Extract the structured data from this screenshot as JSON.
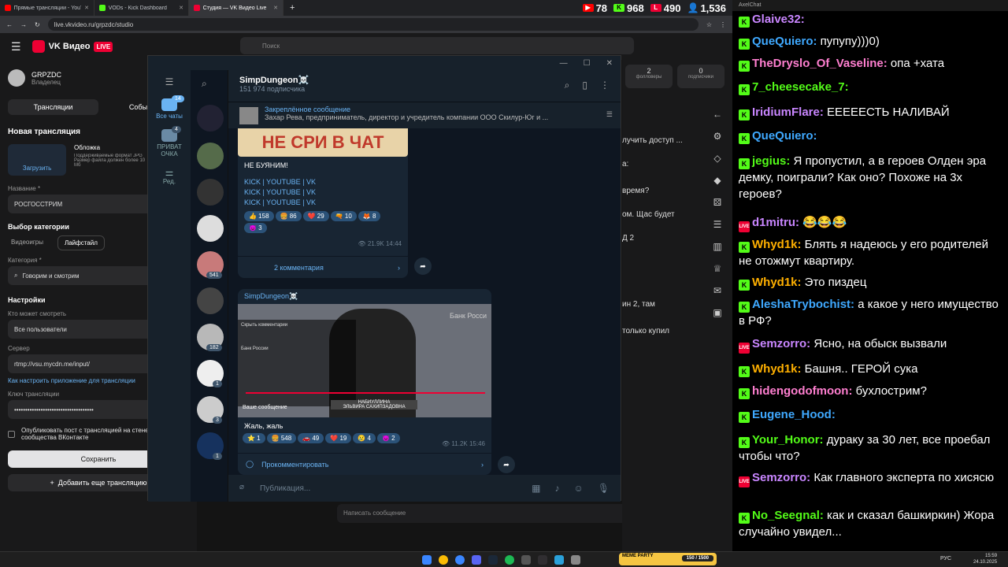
{
  "tabs": [
    {
      "label": "Прямые трансляции - YouTube",
      "color": "#ff0000"
    },
    {
      "label": "VODs - Kick Dashboard",
      "color": "#53fc18"
    },
    {
      "label": "Студия — VK Видео Live",
      "color": "#e03"
    }
  ],
  "stats": {
    "youtube": "78",
    "kick": "968",
    "vk": "490",
    "viewers": "1,536"
  },
  "address": {
    "url": "live.vkvideo.ru/grpzdc/studio"
  },
  "vk": {
    "logo": "VK Видео",
    "live": "LIVE",
    "search_placeholder": "Поиск",
    "channel": "GRPZDC",
    "role": "Владелец",
    "tab_streams": "Трансляции",
    "tab_events": "События",
    "new_stream": "Новая трансляция",
    "upload": "Загрузить",
    "cover_title": "Обложка",
    "cover_desc": "Поддерживаемые формат JPG Размер файла должен более 10 Мб",
    "name_label": "Название *",
    "name_value": "РОСГОССТРИМ",
    "category_title": "Выбор категории",
    "cat_games": "Видеоигры",
    "cat_life": "Лайфстайл",
    "category_label": "Категория *",
    "category_value": "Говорим и смотрим",
    "settings": "Настройки",
    "who_label": "Кто может смотреть",
    "who_value": "Все пользователи",
    "server_label": "Сервер",
    "server_value": "rtmp://vsu.mycdn.me/input/",
    "howto": "Как настроить приложение для трансляции",
    "key_label": "Ключ трансляции",
    "key_value": "••••••••••••••••••••••••••••••••••••",
    "publish": "Опубликовать пост с трансляцией на стене сообщества ВКонтакте",
    "save": "Сохранить",
    "add_more": "Добавить еще трансляцию",
    "followers": "2",
    "followers_label": "фолловеры",
    "subs": "0",
    "subs_label": "подписчики",
    "write_placeholder": "Написать сообщение",
    "side_lines": [
      "лучить доступ ...",
      "а:",
      "время?",
      "ом. Щас будет",
      "Д 2",
      "ин 2, там",
      "только купил"
    ]
  },
  "telegram": {
    "folder_all": "Все чаты",
    "folder_all_count": "14",
    "folder_private": "ПРИВАТ ОЧКА",
    "folder_private_count": "4",
    "folder_edit": "Ред.",
    "list_counts": [
      "541",
      "182",
      "1",
      "3",
      "1"
    ],
    "channel_name": "SimpDungeon☠️",
    "subscribers": "151 974 подписчика",
    "pinned_title": "Закреплённое сообщение",
    "pinned_body": "Захар Рева, предприниматель, директор и учредитель компании ООО Скилур-Юг и ...",
    "post1": {
      "banner": "НЕ СРИ В ЧАТ",
      "line1": "НЕ БУЯНИМ!",
      "links": [
        "KICK | YOUTUBE | VK",
        "KICK | YOUTUBE | VK",
        "KICK | YOUTUBE | VK"
      ],
      "reactions": [
        "👍 158",
        "🍔 86",
        "❤️ 29",
        "🔫 10",
        "🦊 8",
        "😈 3"
      ],
      "views": "21.9K",
      "time": "14:44",
      "comments": "2 комментария"
    },
    "post2": {
      "author": "SimpDungeon☠️",
      "video_top": "Скрыть комментарии",
      "video_bank": "Банк России",
      "video_name": "НАБИУЛЛИНА",
      "video_sub": "ЭЛЬВИРА САХИПЗАДОВНА",
      "video_msg": "Ваше сообщение",
      "video_bank_right": "Банк Росси",
      "text": "Жаль, жаль",
      "reactions": [
        "⭐ 1",
        "🍔 548",
        "🚗 49",
        "❤️ 19",
        "😢 4",
        "😈 2"
      ],
      "views": "11.2K",
      "time": "15:46",
      "comment_btn": "Прокомментировать"
    },
    "compose_placeholder": "Публикация..."
  },
  "chat": {
    "title": "AxelChat",
    "messages": [
      {
        "badge": "kick",
        "user": "Glaive32:",
        "color": "#c986ff",
        "text": ""
      },
      {
        "badge": "kick",
        "user": "QueQuiero:",
        "color": "#3fa9ff",
        "text": " пупупу)))0)"
      },
      {
        "badge": "kick",
        "user": "TheDryslo_Of_Vaseline:",
        "color": "#ff7fd0",
        "text": " опа +хата"
      },
      {
        "badge": "kick",
        "user": "7_cheesecake_7:",
        "color": "#53fc18",
        "text": ""
      },
      {
        "badge": "kick",
        "user": "IridiumFlare:",
        "color": "#c986ff",
        "text": " ЕЕЕЕЕСТЬ НАЛИВАЙ"
      },
      {
        "badge": "kick",
        "user": "QueQuiero:",
        "color": "#3fa9ff",
        "text": ""
      },
      {
        "badge": "kick",
        "user": "jegius:",
        "color": "#53fc18",
        "text": " Я пропустил, а в героев Олден эра демку, поиграли? Как оно? Похоже на 3х героев?"
      },
      {
        "badge": "vk",
        "user": "d1mitru:",
        "color": "#c986ff",
        "text": " 😂😂😂"
      },
      {
        "badge": "kick",
        "user": "Whyd1k:",
        "color": "#ffb000",
        "text": " Блять я надеюсь у его родителей не отожмут квартиру."
      },
      {
        "badge": "kick",
        "user": "Whyd1k:",
        "color": "#ffb000",
        "text": " Это пиздец"
      },
      {
        "badge": "kick",
        "user": "AleshaTrybochist:",
        "color": "#3fa9ff",
        "text": " а какое у него имущество в РФ?"
      },
      {
        "badge": "vk",
        "user": "Semzorro:",
        "color": "#c986ff",
        "text": " Ясно, на обыск вызвали"
      },
      {
        "badge": "kick",
        "user": "Whyd1k:",
        "color": "#ffb000",
        "text": " Башня.. ГЕРОЙ сука"
      },
      {
        "badge": "kick",
        "user": "hidengodofmoon:",
        "color": "#ff7fd0",
        "text": " бухлострим?"
      },
      {
        "badge": "kick",
        "user": "Eugene_Hood:",
        "color": "#3fa9ff",
        "text": ""
      },
      {
        "badge": "kick",
        "user": "Your_Honor:",
        "color": "#53fc18",
        "text": " дураку за 30 лет, все проебал чтобы что?"
      },
      {
        "badge": "vk",
        "user": "Semzorro:",
        "color": "#c986ff",
        "text": " Как главного эксперта по хисясю"
      },
      {
        "badge": "kick",
        "user": "No_Seegnal:",
        "color": "#53fc18",
        "text": " как и сказал башкиркин) Жора случайно увидел..."
      }
    ]
  },
  "taskbar": {
    "lang": "РУС",
    "time": "15:59",
    "date": "24.10.2025",
    "meme": "MEME PARTY",
    "meme_progress": "150 / 1500"
  }
}
